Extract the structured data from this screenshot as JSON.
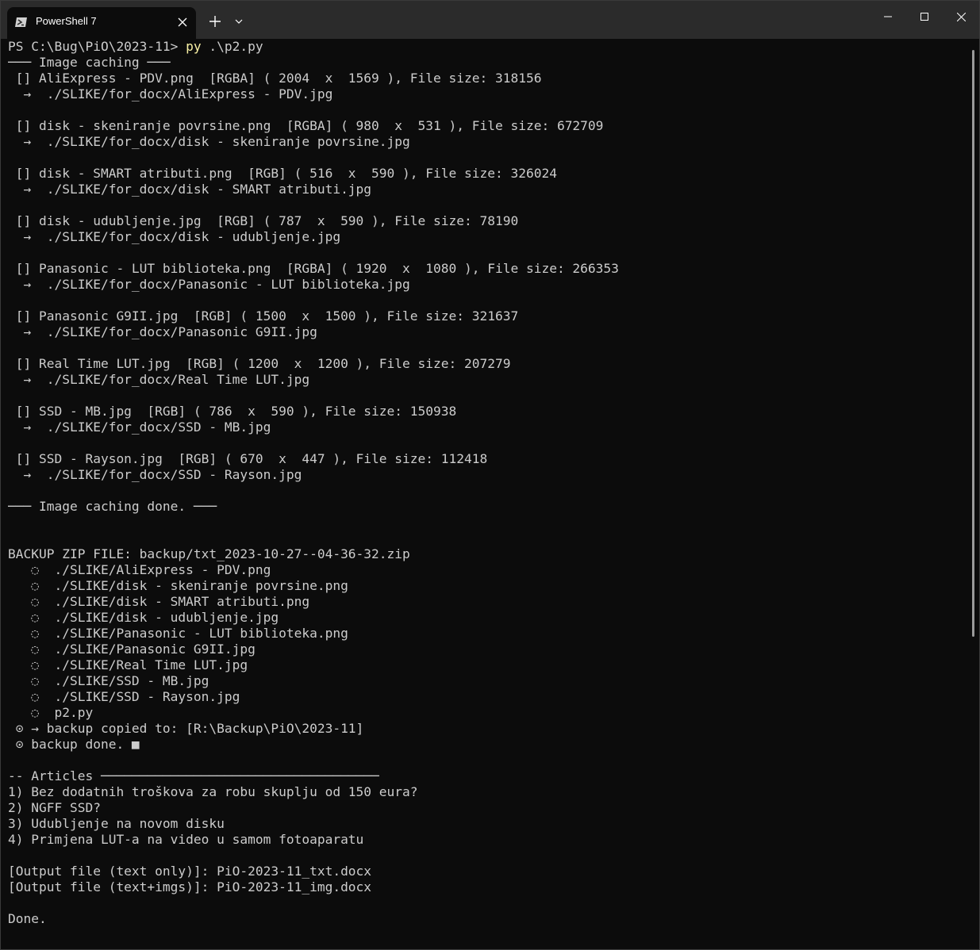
{
  "window": {
    "tab_title": "PowerShell 7",
    "new_tab_glyph": "+",
    "dropdown_glyph": "⌄",
    "close_glyph": "✕"
  },
  "terminal": {
    "prompt": "PS C:\\Bug\\PiO\\2023-11> ",
    "command": "py",
    "command_args": " .\\p2.py",
    "lines": [
      "─── Image caching ───",
      " [] AliExpress - PDV.png  [RGBA] ( 2004  x  1569 ), File size: 318156",
      "  →  ./SLIKE/for_docx/AliExpress - PDV.jpg",
      "",
      " [] disk - skeniranje povrsine.png  [RGBA] ( 980  x  531 ), File size: 672709",
      "  →  ./SLIKE/for_docx/disk - skeniranje povrsine.jpg",
      "",
      " [] disk - SMART atributi.png  [RGB] ( 516  x  590 ), File size: 326024",
      "  →  ./SLIKE/for_docx/disk - SMART atributi.jpg",
      "",
      " [] disk - udubljenje.jpg  [RGB] ( 787  x  590 ), File size: 78190",
      "  →  ./SLIKE/for_docx/disk - udubljenje.jpg",
      "",
      " [] Panasonic - LUT biblioteka.png  [RGBA] ( 1920  x  1080 ), File size: 266353",
      "  →  ./SLIKE/for_docx/Panasonic - LUT biblioteka.jpg",
      "",
      " [] Panasonic G9II.jpg  [RGB] ( 1500  x  1500 ), File size: 321637",
      "  →  ./SLIKE/for_docx/Panasonic G9II.jpg",
      "",
      " [] Real Time LUT.jpg  [RGB] ( 1200  x  1200 ), File size: 207279",
      "  →  ./SLIKE/for_docx/Real Time LUT.jpg",
      "",
      " [] SSD - MB.jpg  [RGB] ( 786  x  590 ), File size: 150938",
      "  →  ./SLIKE/for_docx/SSD - MB.jpg",
      "",
      " [] SSD - Rayson.jpg  [RGB] ( 670  x  447 ), File size: 112418",
      "  →  ./SLIKE/for_docx/SSD - Rayson.jpg",
      "",
      "─── Image caching done. ───",
      "",
      "",
      "BACKUP ZIP FILE: backup/txt_2023-10-27--04-36-32.zip",
      "   ◌  ./SLIKE/AliExpress - PDV.png",
      "   ◌  ./SLIKE/disk - skeniranje povrsine.png",
      "   ◌  ./SLIKE/disk - SMART atributi.png",
      "   ◌  ./SLIKE/disk - udubljenje.jpg",
      "   ◌  ./SLIKE/Panasonic - LUT biblioteka.png",
      "   ◌  ./SLIKE/Panasonic G9II.jpg",
      "   ◌  ./SLIKE/Real Time LUT.jpg",
      "   ◌  ./SLIKE/SSD - MB.jpg",
      "   ◌  ./SLIKE/SSD - Rayson.jpg",
      "   ◌  p2.py",
      " ⊙ → backup copied to: [R:\\Backup\\PiO\\2023-11]",
      " ⊙ backup done. ■",
      "",
      "-- Articles ────────────────────────────────────",
      "1) Bez dodatnih troškova za robu skuplju od 150 eura?",
      "2) NGFF SSD?",
      "3) Udubljenje na novom disku",
      "4) Primjena LUT-a na video u samom fotoaparatu",
      "",
      "[Output file (text only)]: PiO-2023-11_txt.docx",
      "[Output file (text+imgs)]: PiO-2023-11_img.docx",
      "",
      "Done."
    ]
  }
}
